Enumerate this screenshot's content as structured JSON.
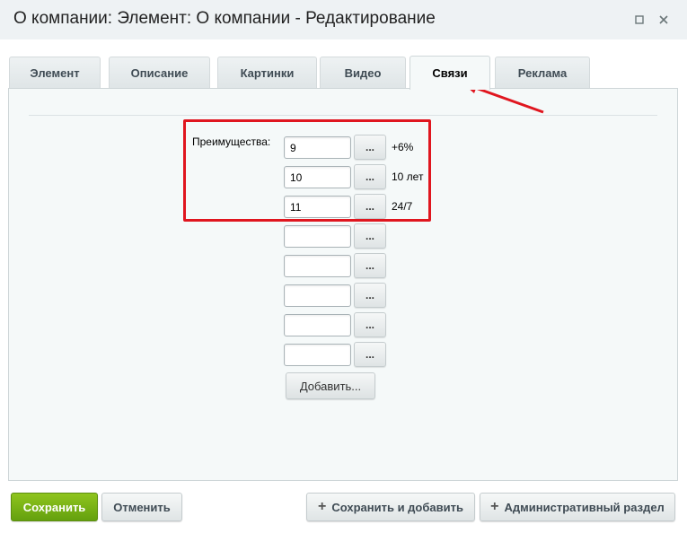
{
  "window": {
    "title": "О компании: Элемент: О компании - Редактирование",
    "maximize_icon": "restore-icon",
    "close_icon": "close-icon"
  },
  "tabs": [
    {
      "label": "Элемент",
      "active": false
    },
    {
      "label": "Описание",
      "active": false
    },
    {
      "label": "Картинки",
      "active": false
    },
    {
      "label": "Видео",
      "active": false
    },
    {
      "label": "Связи",
      "active": true
    },
    {
      "label": "Реклама",
      "active": false
    }
  ],
  "field": {
    "label": "Преимущества:",
    "rows": [
      {
        "value": "9",
        "note": "+6%"
      },
      {
        "value": "10",
        "note": "10 лет"
      },
      {
        "value": "11",
        "note": "24/7"
      },
      {
        "value": "",
        "note": ""
      },
      {
        "value": "",
        "note": ""
      },
      {
        "value": "",
        "note": ""
      },
      {
        "value": "",
        "note": ""
      },
      {
        "value": "",
        "note": ""
      }
    ],
    "browse_label": "...",
    "add_label": "Добавить..."
  },
  "footer": {
    "save": "Сохранить",
    "cancel": "Отменить",
    "save_and_add": "Сохранить и добавить",
    "admin_section": "Административный раздел"
  },
  "colors": {
    "highlight": "#e0161f",
    "save_button": "#75b016"
  }
}
